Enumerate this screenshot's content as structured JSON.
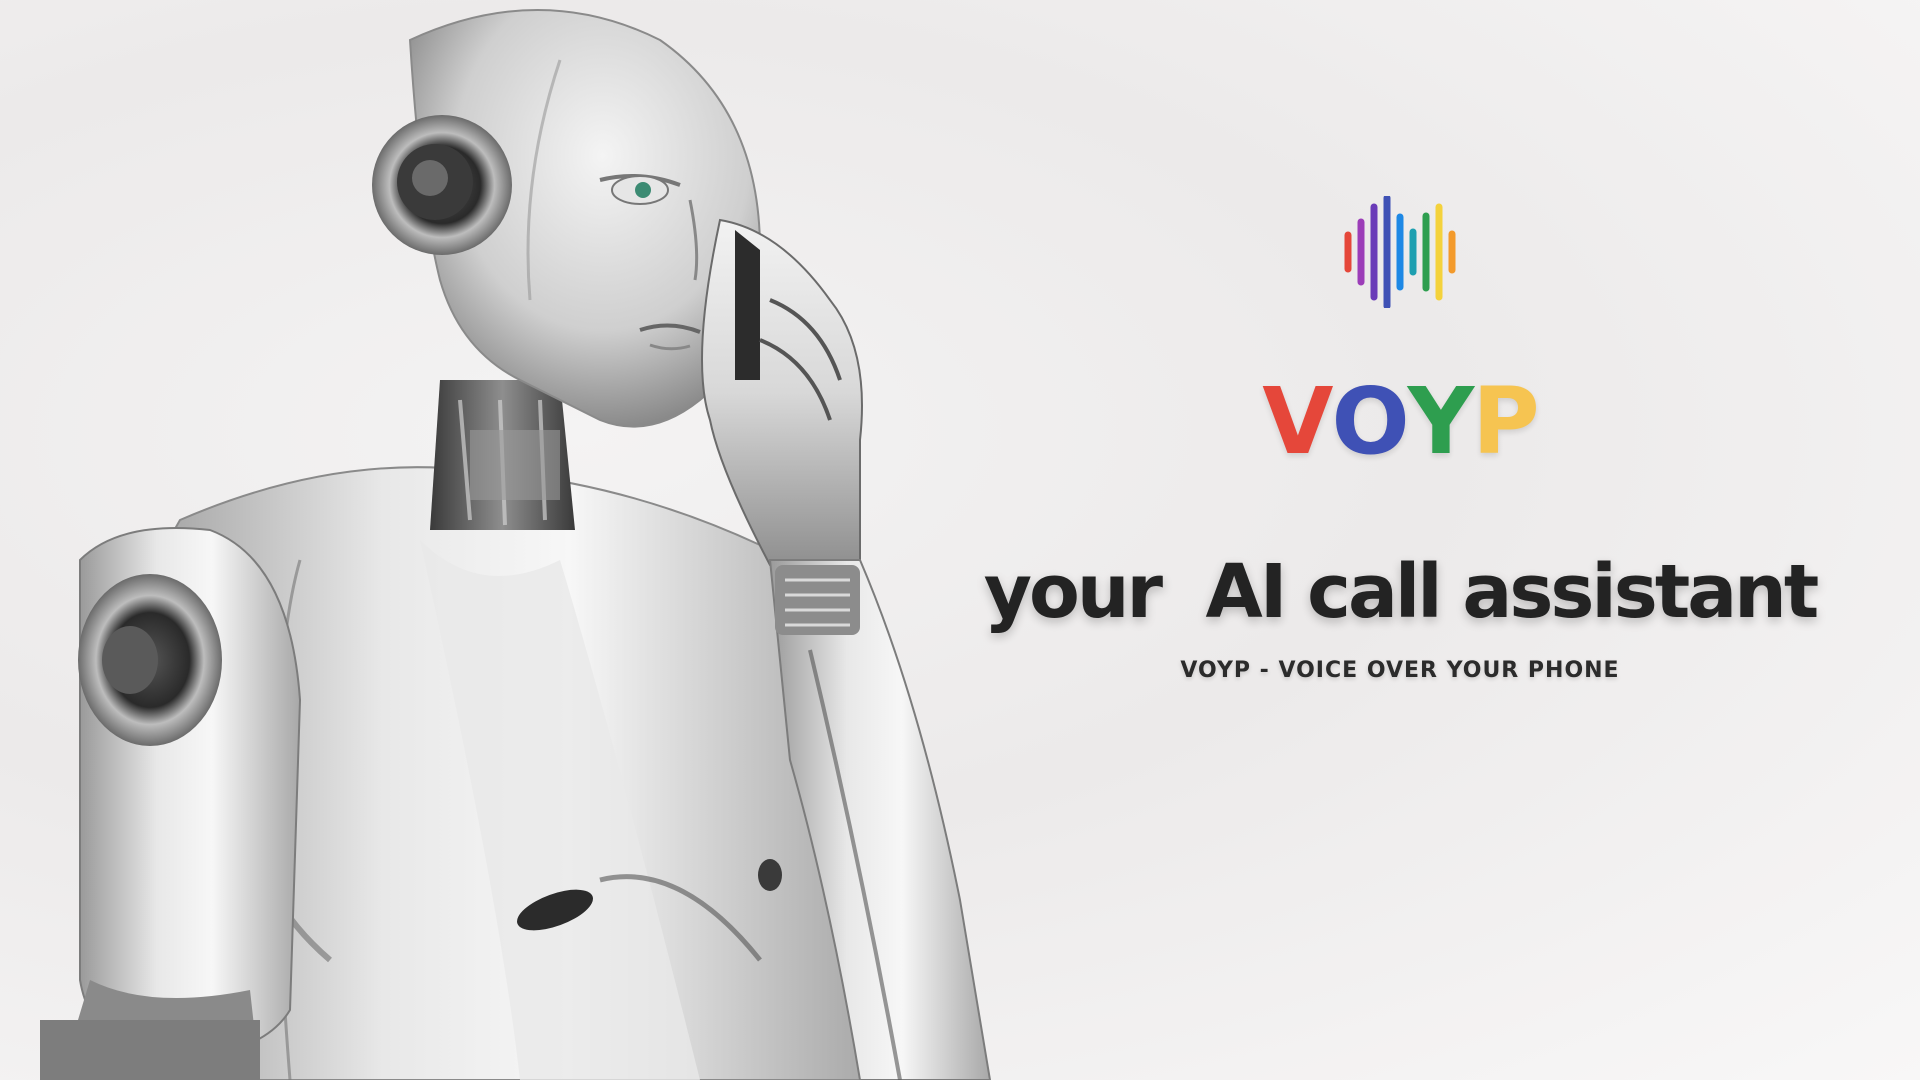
{
  "brand": {
    "logo_icon": "soundwave-icon",
    "logo_letters": [
      {
        "char": "V",
        "color": "#E5473A"
      },
      {
        "char": "O",
        "color": "#3F51B5"
      },
      {
        "char": "Y",
        "color": "#2E9E4F"
      },
      {
        "char": "P",
        "color": "#F6C451"
      }
    ],
    "tagline": "your  AI call assistant",
    "subtagline": "VOYP - VOICE OVER YOUR PHONE"
  },
  "illustration": {
    "subject": "robot-on-phone"
  },
  "colors": {
    "wave": [
      "#E5473A",
      "#9C3DB8",
      "#6A3BB8",
      "#3F51B5",
      "#1E88E5",
      "#1E9FB0",
      "#2E9E4F",
      "#F4D23C",
      "#F39A2B"
    ]
  }
}
